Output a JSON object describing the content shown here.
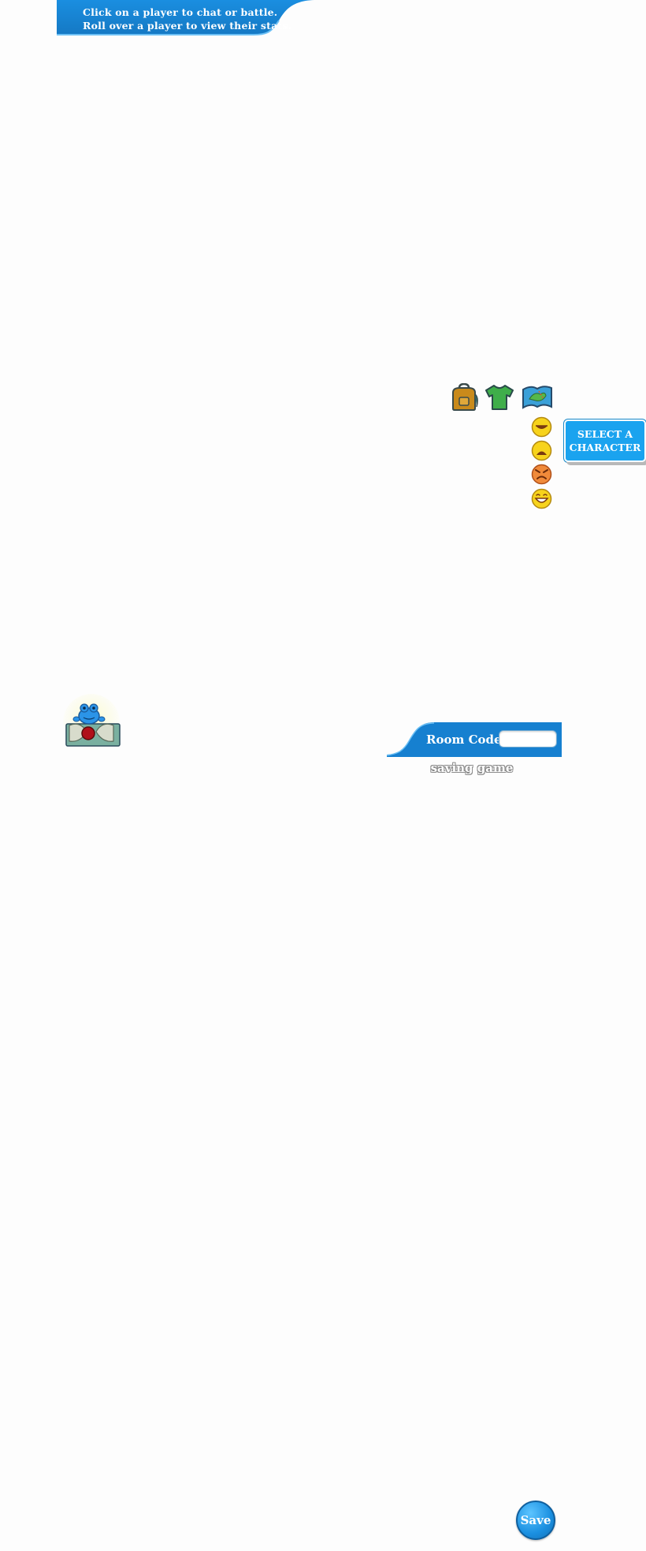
{
  "banner": {
    "line1": "Click on a player to chat or battle.",
    "line2": "Roll over a player to view their stats."
  },
  "toolbar": {
    "items": [
      {
        "icon": "backpack-icon"
      },
      {
        "icon": "shirt-icon"
      },
      {
        "icon": "map-icon"
      }
    ]
  },
  "emotes": [
    {
      "icon": "happy-emote-icon"
    },
    {
      "icon": "sad-emote-icon"
    },
    {
      "icon": "angry-emote-icon"
    },
    {
      "icon": "laughing-emote-icon"
    }
  ],
  "select_character": {
    "line1": "SELECT A",
    "line2": "CHARACTER"
  },
  "room": {
    "label": "Room Code:",
    "value": ""
  },
  "status": {
    "saving": "saving game"
  },
  "save_button": {
    "label": "Save"
  },
  "colors": {
    "banner_blue": "#1a86d6",
    "button_blue": "#1aa3ef"
  }
}
